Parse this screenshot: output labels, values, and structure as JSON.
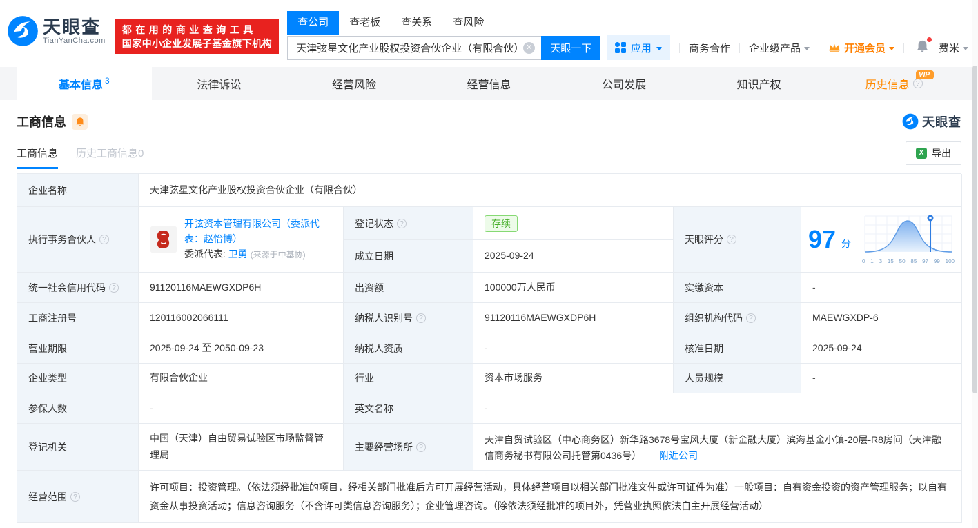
{
  "colors": {
    "brand_blue": "#0084ff",
    "promo_red": "#e8221f",
    "vip_orange": "#ff8000",
    "status_green": "#49b02d",
    "label_cell_bg": "#f0f5fa"
  },
  "header": {
    "logo": {
      "brand": "天眼查",
      "domain": "TianYanCha.com"
    },
    "promo": {
      "line1": "都在用的商业查询工具",
      "line2": "国家中小企业发展子基金旗下机构"
    },
    "search": {
      "tabs": [
        {
          "label": "查公司"
        },
        {
          "label": "查老板"
        },
        {
          "label": "查关系"
        },
        {
          "label": "查风险"
        }
      ],
      "value": "天津弦星文化产业股权投资合伙企业（有限合伙）",
      "button": "天眼一下"
    },
    "menu": {
      "apps": "应用",
      "cooperation": "商务合作",
      "enterprise": "企业级产品",
      "vip": "开通会员",
      "user": "费米"
    }
  },
  "nav": {
    "tabs": [
      {
        "label": "基本信息",
        "count": "3"
      },
      {
        "label": "法律诉讼"
      },
      {
        "label": "经营风险"
      },
      {
        "label": "经营信息"
      },
      {
        "label": "公司发展"
      },
      {
        "label": "知识产权"
      },
      {
        "label": "历史信息",
        "vip": "VIP"
      }
    ]
  },
  "section": {
    "title": "工商信息",
    "brand": "天眼查",
    "subtabs": [
      {
        "label": "工商信息"
      },
      {
        "label": "历史工商信息0"
      }
    ],
    "export": "导出"
  },
  "table": {
    "company_name": {
      "label": "企业名称",
      "value": "天津弦星文化产业股权投资合伙企业（有限合伙）"
    },
    "executive_partner": {
      "label": "执行事务合伙人",
      "link": "开弦资本管理有限公司（委派代表：赵怡博）",
      "rep_label": "委派代表:",
      "rep_name": "卫勇",
      "rep_source": "(来源于中基协)"
    },
    "registration_status": {
      "label": "登记状态",
      "value": "存续"
    },
    "establish_date": {
      "label": "成立日期",
      "value": "2025-09-24"
    },
    "score": {
      "label": "天眼评分",
      "value": "97",
      "unit": "分",
      "axis_labels": [
        "0",
        "1",
        "3",
        "15",
        "50",
        "85",
        "97",
        "99",
        "100"
      ],
      "marker_at": "97"
    },
    "credit_code": {
      "label": "统一社会信用代码",
      "value": "91120116MAEWGXDP6H"
    },
    "contribution": {
      "label": "出资额",
      "value": "100000万人民币"
    },
    "paid_capital": {
      "label": "实缴资本",
      "value": "-"
    },
    "reg_number": {
      "label": "工商注册号",
      "value": "120116002066111"
    },
    "taxpayer_id": {
      "label": "纳税人识别号",
      "value": "91120116MAEWGXDP6H"
    },
    "org_code": {
      "label": "组织机构代码",
      "value": "MAEWGXDP-6"
    },
    "business_term": {
      "label": "营业期限",
      "value": "2025-09-24 至 2050-09-23"
    },
    "taxpayer_quality": {
      "label": "纳税人资质",
      "value": "-"
    },
    "approval_date": {
      "label": "核准日期",
      "value": "2025-09-24"
    },
    "company_type": {
      "label": "企业类型",
      "value": "有限合伙企业"
    },
    "industry": {
      "label": "行业",
      "value": "资本市场服务"
    },
    "staff_size": {
      "label": "人员规模",
      "value": "-"
    },
    "insured_count": {
      "label": "参保人数",
      "value": "-"
    },
    "english_name": {
      "label": "英文名称",
      "value": "-"
    },
    "registry": {
      "label": "登记机关",
      "value": "中国（天津）自由贸易试验区市场监督管理局"
    },
    "business_address": {
      "label": "主要经营场所",
      "value": "天津自贸试验区（中心商务区）新华路3678号宝风大厦（新金融大厦）滨海基金小镇-20层-R8房间（天津融信商务秘书有限公司托管第0436号）",
      "nearby": "附近公司"
    },
    "business_scope": {
      "label": "经营范围",
      "value": "许可项目：投资管理。（依法须经批准的项目，经相关部门批准后方可开展经营活动，具体经营项目以相关部门批准文件或许可证件为准）一般项目：自有资金投资的资产管理服务；以自有资金从事投资活动；信息咨询服务（不含许可类信息咨询服务）；企业管理咨询。（除依法须经批准的项目外，凭营业执照依法自主开展经营活动）"
    }
  }
}
